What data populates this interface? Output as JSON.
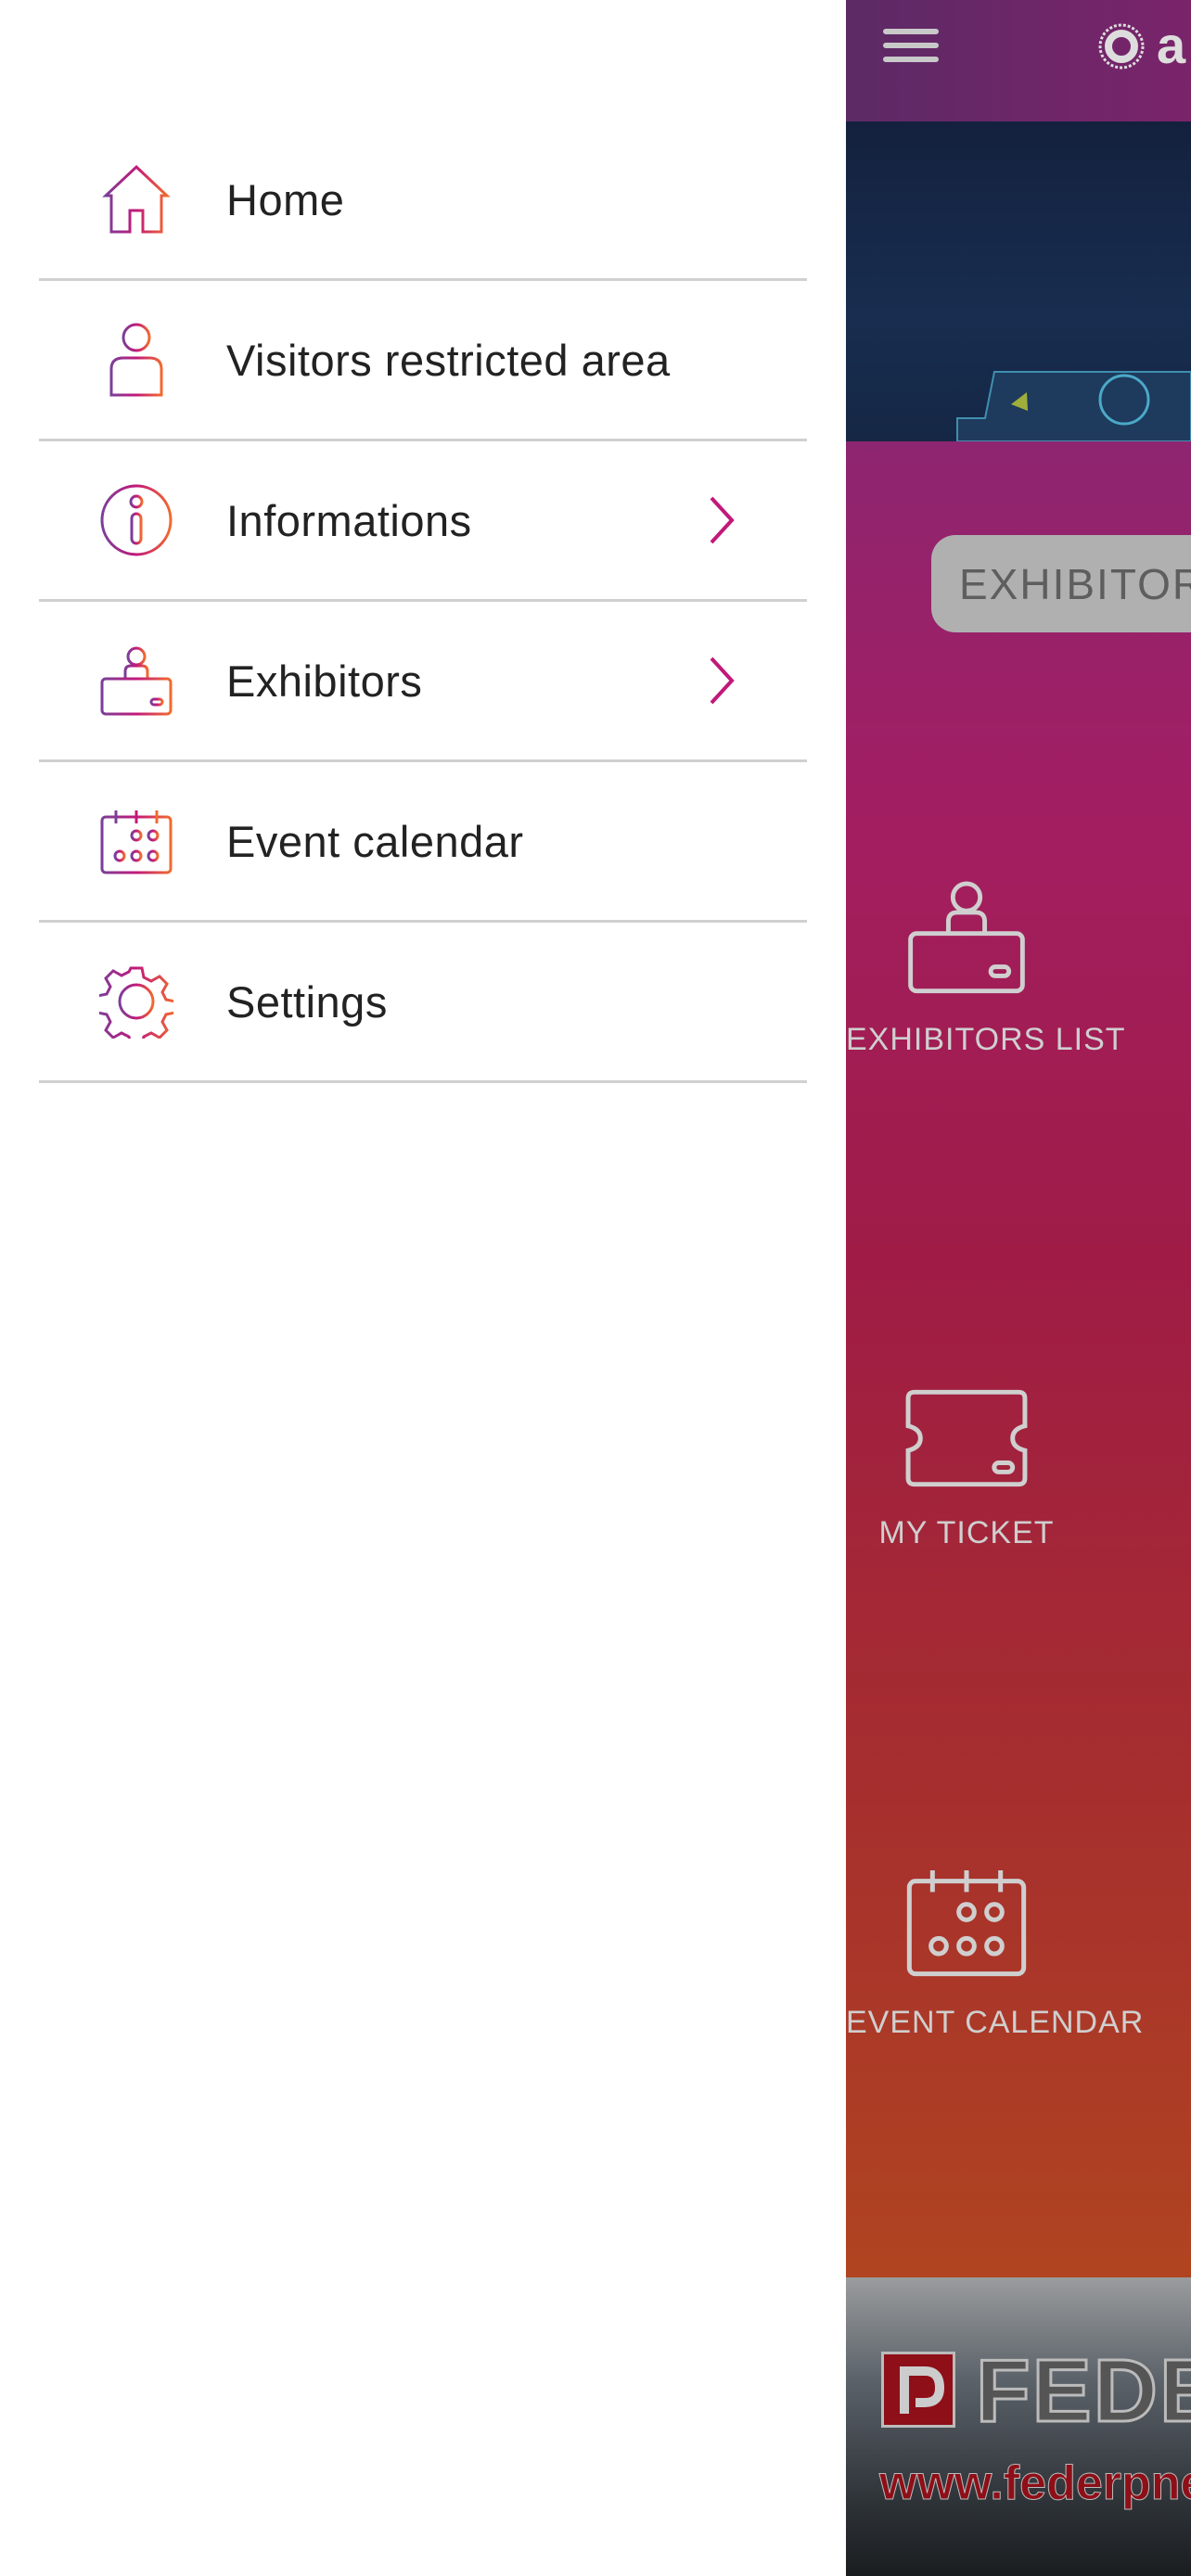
{
  "drawer": {
    "items": [
      {
        "label": "Home",
        "icon": "home-icon",
        "chevron": false
      },
      {
        "label": "Visitors restricted area",
        "icon": "user-icon",
        "chevron": false
      },
      {
        "label": "Informations",
        "icon": "info-icon",
        "chevron": true
      },
      {
        "label": "Exhibitors",
        "icon": "exhibitor-desk-icon",
        "chevron": true
      },
      {
        "label": "Event calendar",
        "icon": "calendar-icon",
        "chevron": false
      },
      {
        "label": "Settings",
        "icon": "gear-icon",
        "chevron": false
      }
    ]
  },
  "main": {
    "search_placeholder": "EXHIBITORS",
    "tiles": [
      {
        "label": "EXHIBITORS LIST"
      },
      {
        "label": "MY TICKET"
      },
      {
        "label": "EVENT CALENDAR"
      }
    ],
    "ad": {
      "text": "FEDERPNEUS",
      "url": "www.federpneus"
    }
  },
  "colors": {
    "gradient_start": "#7b3f98",
    "gradient_mid": "#c2187a",
    "gradient_end": "#f26a2e",
    "divider": "#d0d0d0"
  }
}
